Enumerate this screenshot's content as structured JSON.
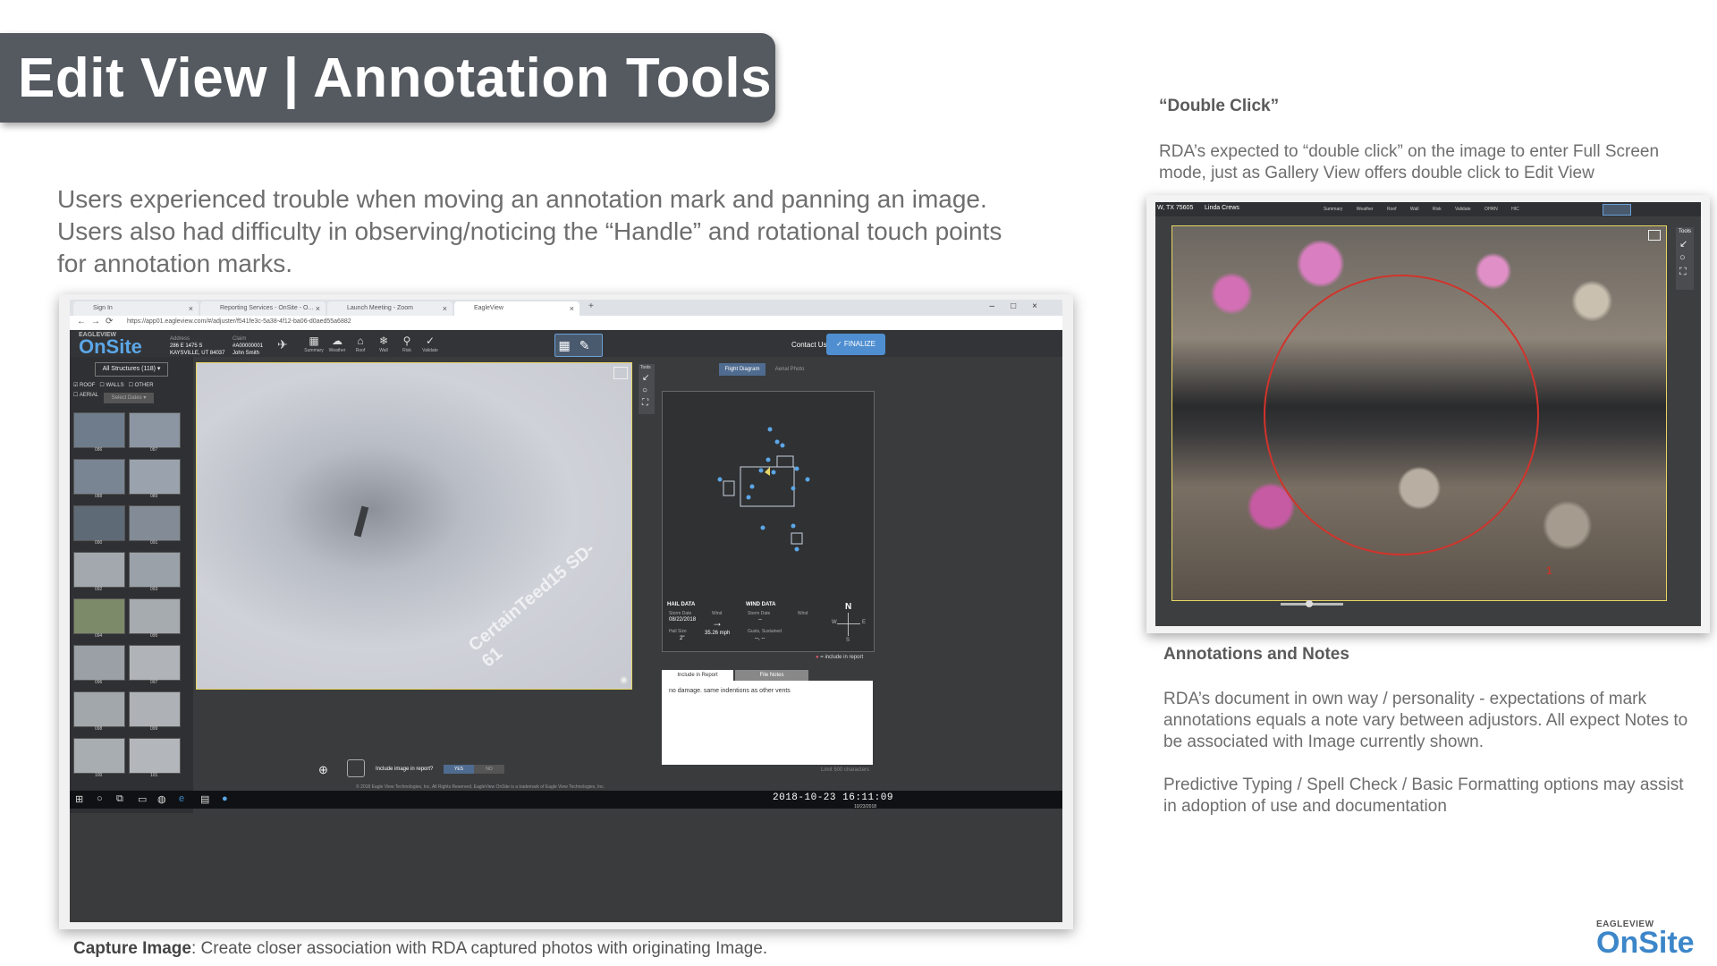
{
  "slide": {
    "title": "Edit View | Annotation Tools",
    "intro_lines": [
      "Users experienced trouble when moving an annotation mark and panning an image.",
      "Users also had difficulty in observing/noticing the “Handle” and rotational touch points",
      "for annotation marks."
    ],
    "caption_bold": "Capture Image",
    "caption_rest": ": Create closer association with RDA captured photos with originating Image.",
    "double_click_heading": "“Double Click”",
    "double_click_text": "RDA’s expected to “double click” on the image to enter Full Screen mode, just as Gallery View offers double click to Edit View",
    "annotations_heading": "Annotations and Notes",
    "annotations_text1": "RDA’s document in own way / personality - expectations of mark annotations equals a note vary between adjustors. All expect Notes to be associated with Image currently shown.",
    "annotations_text2": "Predictive Typing / Spell Check / Basic Formatting options may assist in adoption of use and documentation",
    "logo_top": "EAGLEVIEW",
    "logo_main": "OnSite"
  },
  "browser": {
    "tabs": [
      "Sign In",
      "Reporting Services - OnSite - O...",
      "Launch Meeting - Zoom",
      "EagleView"
    ],
    "url": "https://app01.eagleview.com/#/adjuster/f541fe3c-5a38-4f12-ba06-d0aed55a6882",
    "new_tab": "+"
  },
  "app": {
    "logo_top": "EAGLEVIEW",
    "logo_main": "OnSite",
    "address_label": "Address",
    "address_line1": "286 E 1475 S",
    "address_line2": "KAYSVILLE, UT 84037",
    "claim_label": "Claim",
    "claim_id": "#A00000001",
    "adjuster": "John Smith",
    "tools": [
      {
        "icon": "▦",
        "label": "Summary"
      },
      {
        "icon": "☁",
        "label": "Weather"
      },
      {
        "icon": "⌂",
        "label": "Roof"
      },
      {
        "icon": "❄",
        "label": "Wall"
      },
      {
        "icon": "⚲",
        "label": "Risk"
      },
      {
        "icon": "✓",
        "label": "Validate"
      }
    ],
    "contact": "Contact Us",
    "finalize": "✓  FINALIZE",
    "all_structures": "All Structures (118) ▾",
    "filter_roof": "ROOF",
    "filter_walls": "WALLS",
    "filter_other": "OTHER",
    "filter_aerial": "AERIAL",
    "select_dates": "Select Dates ▾",
    "thumb_labels": [
      "086",
      "087",
      "088",
      "089",
      "090",
      "091",
      "092",
      "093",
      "094",
      "095",
      "096",
      "097",
      "098",
      "099",
      "100",
      "101"
    ],
    "image_watermark": "CertainTeed15 SD-61",
    "tools_label": "Tools",
    "flight_diagram": "Flight Diagram",
    "aerial_photo": "Aerial Photo",
    "hail_data": "HAIL DATA",
    "storm_date_label": "Storm Date",
    "storm_date": "08/22/2018",
    "hail_size_label": "Hail Size",
    "hail_size": "2\"",
    "wind_label_small": "Wind",
    "wind_speed": "35.26 mph",
    "wind_data": "WIND DATA",
    "wind_storm_date_label": "Storm Date",
    "wind_storm_date": "--",
    "wind_col_label": "Wind",
    "gusts_label": "Gusts, Sustained",
    "gusts_value": "--, --",
    "compass_n": "N",
    "compass_s": "S",
    "compass_e": "E",
    "compass_w": "W",
    "include_legend": "= include in report",
    "include_in_report_tab": "Include in Report",
    "file_notes_tab": "File Notes",
    "note_text": "no damage.  same indentions as other vents",
    "limit_text": "Limit 500 characters",
    "include_image_label": "Include image in report?",
    "yes": "YES",
    "no": "NO",
    "copyright": "© 2018 Eagle View Technologies, Inc. All Rights Reserved. EagleView OnSite is a trademark of Eagle View Technologies, Inc.",
    "clock": "2018-10-23  16:11:09",
    "clock_date": "10/23/2018"
  },
  "right_shot": {
    "hdr_address": "W, TX 75605",
    "hdr_name": "Linda Crews",
    "hdr_tools": "Summary Weather Roof Wall Risk Validate OHRN HIC",
    "tools_label": "Tools",
    "mark_number": "1"
  },
  "colors": {
    "title_bg": "#555960",
    "accent_blue": "#4f8fd1",
    "annotation_red": "#d2332b",
    "image_border": "#e6d564"
  }
}
